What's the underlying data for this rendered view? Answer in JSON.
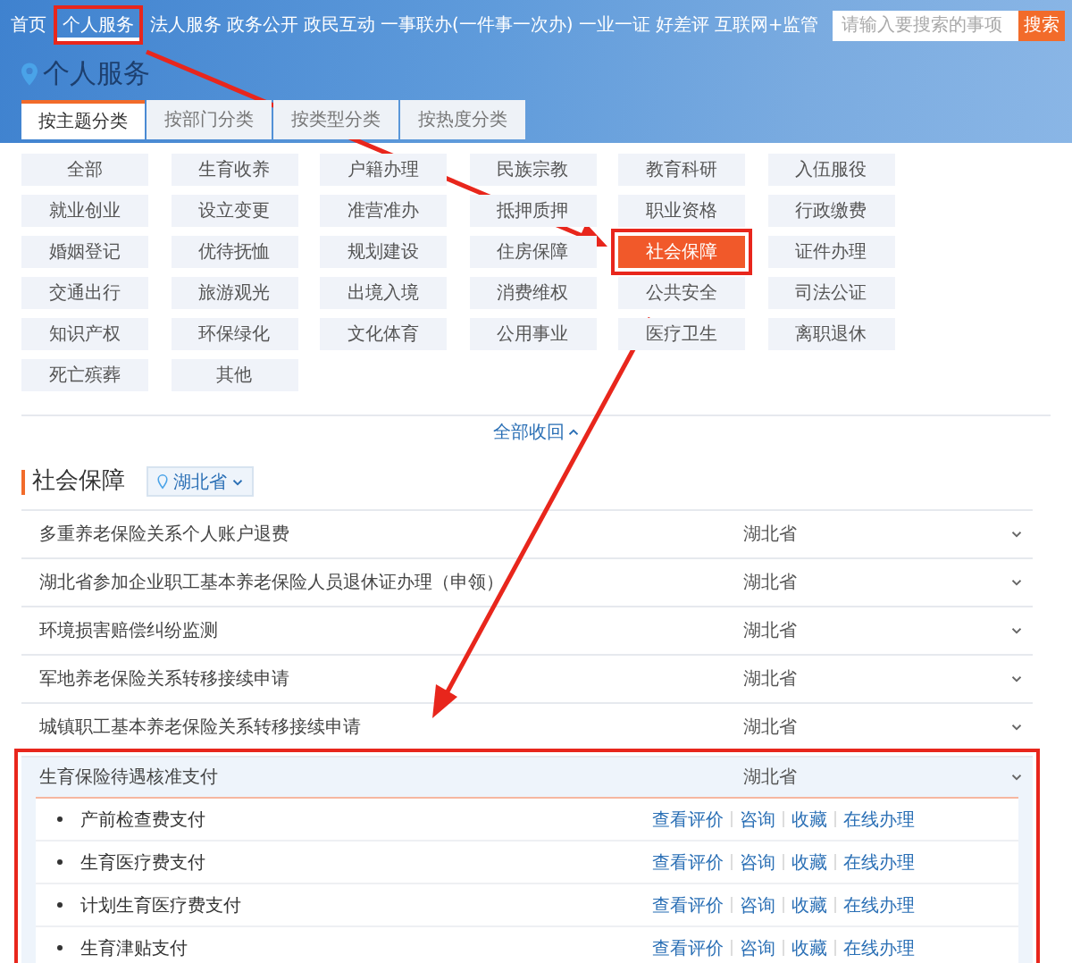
{
  "nav": [
    {
      "label": "首页",
      "selected": false,
      "highlighted": false
    },
    {
      "label": "个人服务",
      "selected": true,
      "highlighted": true
    },
    {
      "label": "法人服务",
      "selected": false,
      "highlighted": false
    },
    {
      "label": "政务公开",
      "selected": false,
      "highlighted": false
    },
    {
      "label": "政民互动",
      "selected": false,
      "highlighted": false
    },
    {
      "label": "一事联办(一件事一次办)",
      "selected": false,
      "highlighted": false
    },
    {
      "label": "一业一证",
      "selected": false,
      "highlighted": false
    },
    {
      "label": "好差评",
      "selected": false,
      "highlighted": false
    },
    {
      "label": "互联网+监管",
      "selected": false,
      "highlighted": false
    }
  ],
  "search": {
    "placeholder": "请输入要搜索的事项",
    "button": "搜索"
  },
  "page_title": "个人服务",
  "tabs": [
    {
      "label": "按主题分类",
      "selected": true
    },
    {
      "label": "按部门分类",
      "selected": false
    },
    {
      "label": "按类型分类",
      "selected": false
    },
    {
      "label": "按热度分类",
      "selected": false
    }
  ],
  "categories": [
    {
      "label": "全部",
      "selected": false
    },
    {
      "label": "生育收养",
      "selected": false
    },
    {
      "label": "户籍办理",
      "selected": false
    },
    {
      "label": "民族宗教",
      "selected": false
    },
    {
      "label": "教育科研",
      "selected": false
    },
    {
      "label": "入伍服役",
      "selected": false
    },
    {
      "label": "就业创业",
      "selected": false
    },
    {
      "label": "设立变更",
      "selected": false
    },
    {
      "label": "准营准办",
      "selected": false
    },
    {
      "label": "抵押质押",
      "selected": false
    },
    {
      "label": "职业资格",
      "selected": false
    },
    {
      "label": "行政缴费",
      "selected": false
    },
    {
      "label": "婚姻登记",
      "selected": false
    },
    {
      "label": "优待抚恤",
      "selected": false
    },
    {
      "label": "规划建设",
      "selected": false
    },
    {
      "label": "住房保障",
      "selected": false
    },
    {
      "label": "社会保障",
      "selected": true
    },
    {
      "label": "证件办理",
      "selected": false
    },
    {
      "label": "交通出行",
      "selected": false
    },
    {
      "label": "旅游观光",
      "selected": false
    },
    {
      "label": "出境入境",
      "selected": false
    },
    {
      "label": "消费维权",
      "selected": false
    },
    {
      "label": "公共安全",
      "selected": false
    },
    {
      "label": "司法公证",
      "selected": false
    },
    {
      "label": "知识产权",
      "selected": false
    },
    {
      "label": "环保绿化",
      "selected": false
    },
    {
      "label": "文化体育",
      "selected": false
    },
    {
      "label": "公用事业",
      "selected": false
    },
    {
      "label": "医疗卫生",
      "selected": false
    },
    {
      "label": "离职退休",
      "selected": false
    },
    {
      "label": "死亡殡葬",
      "selected": false
    },
    {
      "label": "其他",
      "selected": false
    }
  ],
  "collapse_link": "全部收回",
  "section": {
    "title": "社会保障",
    "region": "湖北省"
  },
  "items": [
    {
      "name": "多重养老保险关系个人账户退费",
      "region": "湖北省",
      "expanded": false
    },
    {
      "name": "湖北省参加企业职工基本养老保险人员退休证办理（申领）",
      "region": "湖北省",
      "expanded": false
    },
    {
      "name": "环境损害赔偿纠纷监测",
      "region": "湖北省",
      "expanded": false
    },
    {
      "name": "军地养老保险关系转移接续申请",
      "region": "湖北省",
      "expanded": false
    },
    {
      "name": "城镇职工基本养老保险关系转移接续申请",
      "region": "湖北省",
      "expanded": false
    },
    {
      "name": "生育保险待遇核准支付",
      "region": "湖北省",
      "expanded": true,
      "children": [
        {
          "name": "产前检查费支付",
          "actions": [
            "查看评价",
            "咨询",
            "收藏",
            "在线办理"
          ]
        },
        {
          "name": "生育医疗费支付",
          "actions": [
            "查看评价",
            "咨询",
            "收藏",
            "在线办理"
          ]
        },
        {
          "name": "计划生育医疗费支付",
          "actions": [
            "查看评价",
            "咨询",
            "收藏",
            "在线办理"
          ]
        },
        {
          "name": "生育津贴支付",
          "actions": [
            "查看评价",
            "咨询",
            "收藏",
            "在线办理"
          ]
        }
      ]
    }
  ]
}
